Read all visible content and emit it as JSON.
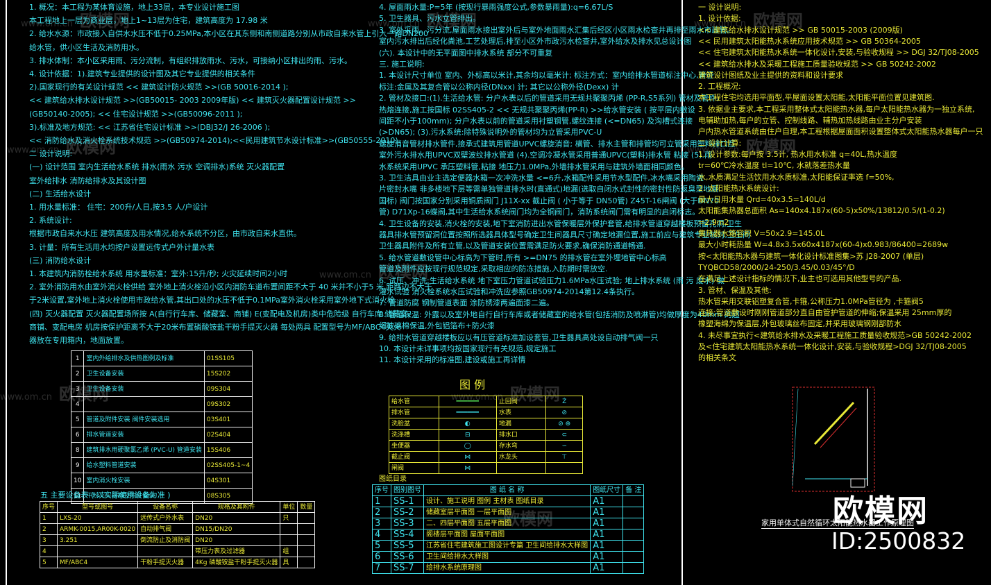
{
  "watermarks": [
    {
      "site": "www.om.cn",
      "brand": "欧模网"
    },
    {
      "site": "www.om.cn",
      "brand": "欧模网"
    },
    {
      "site": "www.om.cn",
      "brand": "欧模网"
    },
    {
      "site": "www.om.cn",
      "brand": "欧模网"
    },
    {
      "site": "www.om.cn",
      "brand": "欧模网"
    },
    {
      "site": "www.om.cn",
      "brand": "欧模网"
    },
    {
      "site": "www.om.cn",
      "brand": "欧模网"
    },
    {
      "site": "www.om.cn",
      "brand": "欧模网"
    },
    {
      "site": "www.om.cn",
      "brand": "欧模网"
    }
  ],
  "left_col": [
    "1. 概况：本工程为某体育设施，地上33层，本专业设计施工图",
    "   本工程地上一层为商业层，地上1~13层为住宅，建筑高度为        17.98 米",
    "2. 给水水源：市政接入自供水水压不低于0.25MPa,本小区在其东侧和南侧道路分别从市政自来水管上引入一路DN200",
    "   给水管，供小区生活及消防用水。",
    "3. 排水体制：本小区采用雨、污分流制，有组织排放雨水、污水，可接纳小区排出的雨、污水。",
    "4. 设计依据：1).建筑专业提供的设计图及其它专业提供的相关条件",
    "           2).国家现行的有关设计规范 << 建筑设计防火规范 >>(GB 50016-2014 );",
    "      << 建筑给水排水设计规范 >>(GB50015- 2003  2009年版) << 建筑灭火器配置设计规范 >>",
    "      (GB50140-2005); << 住宅设计规范 >>(GB50096-2011 );",
    "           3).标准及地方规范: << 江苏省住宅设计标准 >>(DBJ32/J 26-2006 );",
    "      << 消防给水及消火栓系统技术规范 >>(GB50974-2014);<<民用建筑节水设计标准>>(GB50555-2010).",
    "二  设计说明:",
    "(一)  设计范围  室内生活给水系统  排水(雨水 污水 空调排水)系统  灭火器配置",
    "      室外给排水  消防给排水及其设计图",
    "(二)  生活给水设计",
    "  1. 用水量标准：  住宅：200升/人日,按3.5 人/户设计",
    "  2. 系统设计:",
    "     根据市政自来水水压  建筑高度及用水情况,给水系统不分区，由市政自来水直供。",
    "  3. 计量：所有生活用水均按户设置远传式户外计量水表",
    "(三) 消防给水设计",
    "  1. 本建筑内消防栓给水系统  用水量标准：室外:15升/秒;  火灾延续时间2小时",
    "  2. 室外消防用水由室外消火栓供给  室外地上消火栓沿小区内消防车道布置间距不大于 40 米并不小于5 米  距路边不大于",
    "     于2米设置,室外地上消火栓使用市政给水管,其出口处的水压不低于0.1MPa室外消火栓采用室外地下式消火栓",
    "(四)  灭火器配置 灭火器配置场所按 A(自行行车库、储藏室、商铺) E(变配电及机房)类中危险级  自行车库 储藏室、",
    "      商铺、变配电房  机房按保护距离不大于20米布置磷酸铵盐干粉手提灭火器  每处两具  配置型号为MF/ABC4灭火",
    "      器放在专用箱内，地面放置。"
  ],
  "std_table": {
    "rows": [
      {
        "no": "1",
        "desc": "室内外给排水及供热图例及标准",
        "code": "01SS105"
      },
      {
        "no": "2",
        "desc": "卫生设备安装",
        "code": "15S202"
      },
      {
        "no": "3",
        "desc": "卫生设备安装",
        "code": "09S304"
      },
      {
        "no": "4",
        "desc": "",
        "code": "09S302"
      },
      {
        "no": "5",
        "desc": "管道及附件安装  阀件安装选用",
        "code": "03S401"
      },
      {
        "no": "6",
        "desc": "排水管道安装",
        "code": "02S404"
      },
      {
        "no": "8",
        "desc": "建筑排水用硬聚氯乙烯   (PVC-U) 管道安装",
        "code": "15S406"
      },
      {
        "no": "9",
        "desc": "给水塑料管道安装",
        "code": "02SS405-1~4"
      },
      {
        "no": "10",
        "desc": "室内消火栓安装",
        "code": "04S301"
      },
      {
        "no": "11",
        "desc": "干粉灭火器箱及附件安装",
        "code": "08S305"
      }
    ]
  },
  "equip_title": "五 主要设备表 ( 以实际使用设备为准 )",
  "equip_table": {
    "headers": [
      "序号",
      "型号或图号",
      "设备名称",
      "规格及其附件",
      "单位",
      "数量"
    ],
    "rows": [
      [
        "1",
        "LXS-20",
        "远传式户外水表",
        "DN20",
        "只",
        ""
      ],
      [
        "2",
        "ARMK-0015,AR00K-0020",
        "自动排气阀",
        "DN15/DN20",
        "",
        ""
      ],
      [
        "3",
        "3.251",
        "倒流防止及消防阀",
        "DN20",
        "",
        ""
      ],
      [
        "4",
        "",
        "",
        "",
        "组",
        ""
      ],
      [
        "5",
        "MF/ABC4",
        "干粉手提灭火器",
        "4Kg  磷酸铵盐干粉手提灭火器",
        "具",
        ""
      ]
    ],
    "merged_note": "带压力表及过滤器"
  },
  "mid_col": [
    "4. 屋面雨水量:P=5年 (按现行暴雨强度公式,参数暴雨量):q=6.67L/S",
    "5. 卫生器具、污水立管排出。",
    "3. 室外采雨、污分流,屋面雨水接出室外后与室外地面雨水汇集后经区小区雨水检查井再排至雨水市政管。",
    "   室内污水排出后经化粪池,工艺处理后,排至小区外市政污水检查井,室外给水及排水见总设计图",
    "(六).  本设计中的无平面图中排水系统   部分不可重复",
    "三.  施工说明:",
    "1. 本设计尺寸单位  室内、外标高以米计,其余均以毫米计;  标注方式：室内给排水管道标注中心,管径",
    "   标注:金属及其复合管以公称内径(DNxx) 计; 其它以公称外径(Dexx) 计",
    "2. 管材及接口:(1).生活给水管: 分户水表以后的管道采用无规共聚聚丙烯 (PP-R,S5系列) 管材及管件,",
    "   热熔连接,施工按国标 02SS405-2 << 无规共聚聚丙烯(PP-R) >>给水管安装 ( 按平层内敷设",
    "   间距不小于100mm); 分户水表以前的管道采用衬塑钢管,螺纹连接 (<=DN65)  及沟槽式连接",
    "   (>DN65);                        (3).污水系统:除特殊说明外的管材均为立管采用PVC-U",
    "   螺旋消音管材排水管件,接承式建筑用管道UPVC螺旋消音;  横管、排水主管和排管均可立管采用塑料排口互",
    "   室外污水排水用UPVC双壁波纹排水管道 (4).空调冷凝水管采用普通UPVC(塑料)排水管  粘接 (5).雨",
    "   水系统采用UPVC 承压塑料管,粘接  地压力1.0MPa,外墙排水管采用与建筑外墙面相同颜色。",
    "3. 卫生洁具由业主选定便器水箱一次冲洗水量 <=6升,水箱配件采用节水型配件,冰水嘴采用陶瓷",
    "   片密封水嘴  非多楼地下层等需单独管道排水时(直通式)地漏(选取自闭水式封性的密封性防返臭型地漏",
    "   国标) 阀门按国家分别采用铜质阀门 J11X-xx 截止阀 ( 小于等于 DN50管)  Z45T-16闸阀 (大于DN70",
    "   管)    D71Xp-16蝶阀,其中生活给水系统阀门均为全铜阀门，消防系统阀门需有明显的启闭标志。",
    "4. 卫生设备的安装,消火栓的安装,地下室消防进出水管保暖层外保护套管,给排水管道穿越楼板预留孔洞,卫生",
    "   器具排水管预留洞位置按照所选器具体型号确定卫生间器具尺寸确定地漏位置,施工前应与建筑专业核对,卫生间",
    "   卫生器具附件及所有立管,以及管道安装位置需满足防火要求,确保消防通道畅通.",
    "5. 给水管道敷设管中心标高为下管时,所有 >=DN75 的排水管在室外埋地管中心标高",
    "   管道及附件应按现行规范规定,采取相应的防冻措施,入防期时需放空.",
    "6. 试压、冲洗:生活给水系统 地下室压力管道试验压力1.6MPa水压试验; 地上排水系统 (雨 污  废水) 做",
    "   灌水试验 消火栓系统水压试验和冲洗应参照GB50974-2014第12.4条执行。",
    "7. 管道防腐  钢制管道表面  涂防锈漆两遍面漆二遍。",
    "8. 管道保温: 外露以及室外地自行自行车库或者储藏室的给水管(包括消防及喷淋管)均做厚度为40mm 的超",
    "   细玻璃棉保温,外包铝箔布+防火漆",
    "9. 给排水管道穿越楼板应以有压管道标准加设套管,卫生器具高处设自动排气阀一只",
    "10. 本设计未详事项均按国家现行有关规范,规定施工",
    "11. 本设计采用的标准图,建设或施工再详情"
  ],
  "legend": {
    "title": "图 例",
    "rows": [
      {
        "l1": "给水管",
        "s1": "━━━━━━",
        "l2": "止回阀",
        "s2": "Ż"
      },
      {
        "l1": "排水管",
        "s1": "━━━━━━",
        "l2": "水表",
        "s2": "⊘"
      },
      {
        "l1": "洗脸盆",
        "s1": "◐",
        "l2": "地漏",
        "s2": "⊘ ⊕"
      },
      {
        "l1": "洗涤槽",
        "s1": "⊟",
        "l2": "排水口",
        "s2": "⊂"
      },
      {
        "l1": "坐便器",
        "s1": "◯",
        "l2": "存水弯",
        "s2": "∽"
      },
      {
        "l1": "截止阀",
        "s1": "⋈",
        "l2": "水龙头",
        "s2": "⊤"
      },
      {
        "l1": "闸阀",
        "s1": "⋈",
        "l2": "",
        "s2": ""
      }
    ]
  },
  "drawings": {
    "title": "图纸目录",
    "headers": [
      "序号",
      "图别图号",
      "图  纸  名  称",
      "图纸尺寸",
      "备   注"
    ],
    "rows": [
      [
        "1",
        "SS-1",
        "设计、施工说明  图例  主材表  图纸目录",
        "A1",
        ""
      ],
      [
        "2",
        "SS-2",
        "储藏室层平面图  一层平面图",
        "A1",
        ""
      ],
      [
        "3",
        "SS-3",
        "二、四层平面图     五层平面图",
        "A1",
        ""
      ],
      [
        "4",
        "SS-4",
        "阁楼层平面图  屋面平面图",
        "A1",
        ""
      ],
      [
        "5",
        "SS-5",
        "江苏省住宅建筑施工图设计专篇 卫生间给排水大样图",
        "A1",
        ""
      ],
      [
        "6",
        "SS-6",
        "卫生间给排水大样图",
        "A1",
        ""
      ],
      [
        "7",
        "SS-7",
        "给排水系统原理图",
        "A1",
        ""
      ]
    ]
  },
  "right_col": [
    "一  设计说明:",
    "1.  设计依据:",
    "    << 建筑给水排水设计规范 >>  GB 50015-2003 (2009版)",
    "    << 民用建筑太阳能热水系统应用技术规范 >>  GB 50364-2005",
    "    << 住宅建筑太阳能热水系统一体化设计,安装,与验收规程 >> DGJ 32/TJ08-2005",
    "    << 建筑给水排水及采暖工程施工质量验收规范 >> GB 50242-2002",
    "    建筑设计图纸及业主提供的资料和设计要求",
    "2.  工程概况:",
    "    本工程住宅均选用平面型,平屋面设置太阳能,太阳能平面位置见建筑图.",
    "3.  依据业主要求,本工程采用整体式太阳能热水器,每户太阳能热水器为一独立系统,",
    "    电辅助加热,每户的立管、控制线路、辅热加热线路由业主分户安装",
    "    户内热水管道系统由住户自理,本工程根据屋面面积设置整体式太阳能热水器每户一只",
    "二  设计计算:",
    "1.  设计参数:每户按 3.5计, 热水用水标准  q=40L,热水温度",
    "    tr=60℃冷水温度         tl=10℃,   水就落差热水量",
    "    水,水质满足生活饮用水水质标准,太阳能保证率选 f=50%,",
    "2.  太阳能热水系统设计:",
    "    最大日用水量 Qrd=40x3.5=140L/d",
    "    太阳能集热器总面积 As=140x4.187x(60-5)x50%/13812/0.5/(1-0.2)",
    "                          =2.9m2",
    "    集热器水箱容积 V=50x2.9=145.0L",
    "    最大小时耗热量  W=4.8x3.5x60x4187x(60-4)x0.983/86400=2689w",
    "    按<太阳能热水器与建筑一体化设计标准图集>苏 J28-2007 (单层)",
    "                              TYQBCD58/2000/24-250/3.45/0.03/45°/D",
    "    在满足上述设计指标的情况下,业主也可选用其他型号的产品.",
    "3.  管材、保温及其他:",
    "    热水管采用交联铝塑复合管,卡箍,公称压力1.0MPa管径为       ,卡箍阀5",
    "    连接;管道敷设时刚刚管道部分直自由管护管道的伸缩;保温采用 25mm厚的",
    "    橡塑海绵为保温层,外包玻璃丝布固定,并采用玻璃钢刚部防水",
    "4.  未尽事宜执行<建筑给水排水及采暖工程施工质量验收规范>GB 50242-2002",
    "    及<住宅建筑太阳能热水系统一体化设计,安装,与验收规程>DGJ 32/TJ08-2005",
    "    的相关条文"
  ],
  "diagram_caption": "家用单体式自然循环太阳能热水器工作原理图",
  "brand": "欧模网",
  "brand_id": "ID:2500832"
}
